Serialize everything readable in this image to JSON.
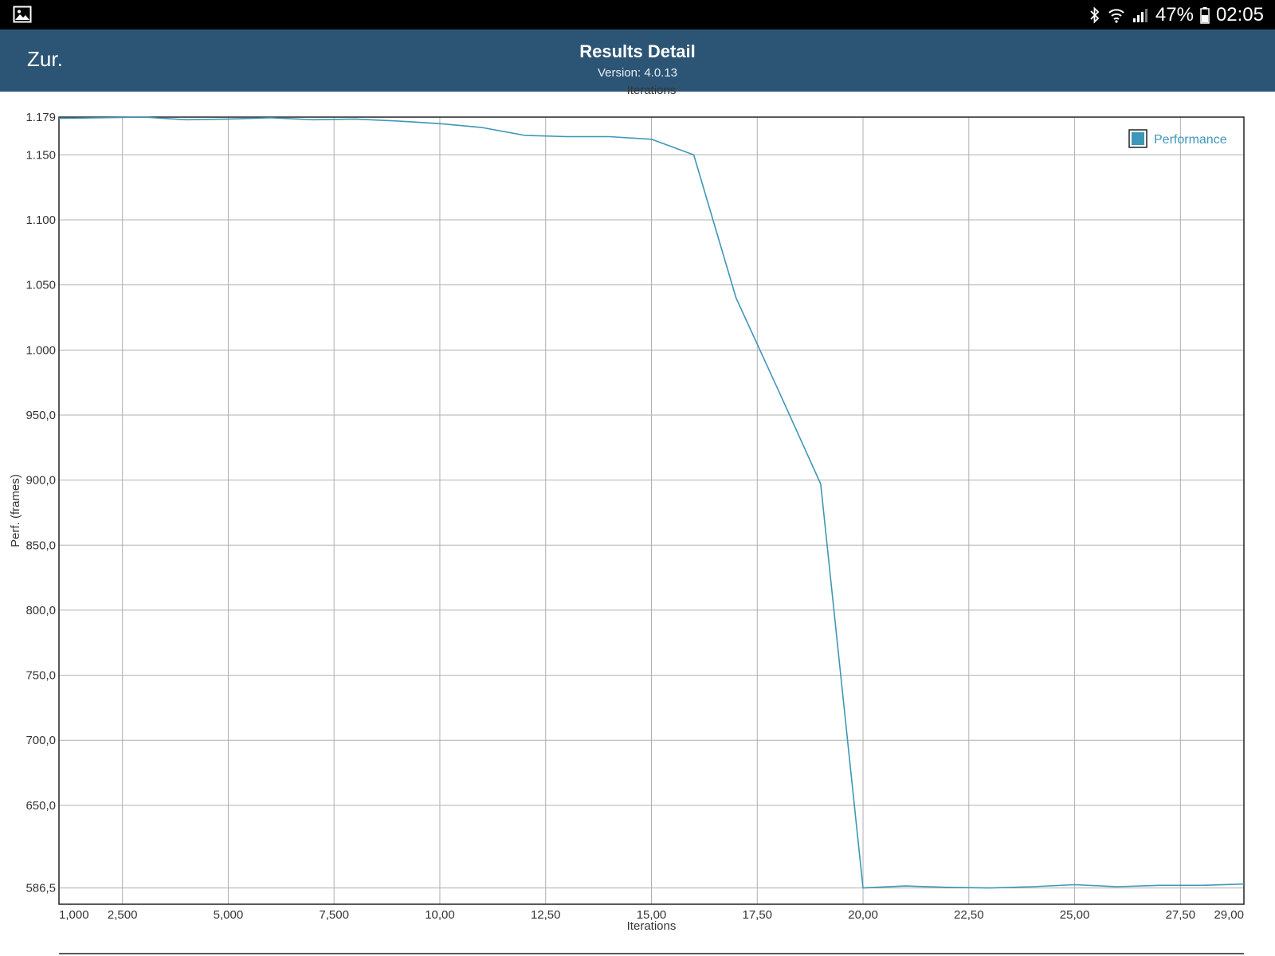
{
  "status_bar": {
    "battery": "47%",
    "time": "02:05",
    "icons": [
      "gallery-icon",
      "bluetooth-icon",
      "wifi-icon",
      "signal-icon",
      "battery-icon"
    ]
  },
  "app_bar": {
    "back_label": "Zur.",
    "title": "Results Detail",
    "subtitle": "Version: 4.0.13"
  },
  "colors": {
    "app_bar": "#2c5575",
    "series": "#3d97b8",
    "grid": "#b0b0b0",
    "frame": "#222222"
  },
  "chart_data": {
    "type": "line",
    "title": "",
    "xlabel": "Iterations",
    "ylabel": "Perf. (frames)",
    "partial_top_label": "Iterations",
    "xlim": [
      1,
      29
    ],
    "ylim": [
      574,
      1179
    ],
    "grid": true,
    "legend_position": "top-right",
    "x_ticks": [
      {
        "value": 1,
        "label": "1,000"
      },
      {
        "value": 2.5,
        "label": "2,500"
      },
      {
        "value": 5,
        "label": "5,000"
      },
      {
        "value": 7.5,
        "label": "7,500"
      },
      {
        "value": 10,
        "label": "10,00"
      },
      {
        "value": 12.5,
        "label": "12,50"
      },
      {
        "value": 15,
        "label": "15,00"
      },
      {
        "value": 17.5,
        "label": "17,50"
      },
      {
        "value": 20,
        "label": "20,00"
      },
      {
        "value": 22.5,
        "label": "22,50"
      },
      {
        "value": 25,
        "label": "25,00"
      },
      {
        "value": 27.5,
        "label": "27,50"
      },
      {
        "value": 29,
        "label": "29,00"
      }
    ],
    "y_ticks": [
      {
        "value": 1179,
        "label": "1.179"
      },
      {
        "value": 1150,
        "label": "1.150"
      },
      {
        "value": 1100,
        "label": "1.100"
      },
      {
        "value": 1050,
        "label": "1.050"
      },
      {
        "value": 1000,
        "label": "1.000"
      },
      {
        "value": 950,
        "label": "950,0"
      },
      {
        "value": 900,
        "label": "900,0"
      },
      {
        "value": 850,
        "label": "850,0"
      },
      {
        "value": 800,
        "label": "800,0"
      },
      {
        "value": 750,
        "label": "750,0"
      },
      {
        "value": 700,
        "label": "700,0"
      },
      {
        "value": 650,
        "label": "650,0"
      },
      {
        "value": 586.5,
        "label": "586,5"
      }
    ],
    "series": [
      {
        "name": "Performance",
        "x": [
          1,
          2,
          3,
          4,
          5,
          6,
          7,
          8,
          9,
          10,
          11,
          12,
          13,
          14,
          15,
          16,
          17,
          18,
          19,
          20,
          21,
          22,
          23,
          24,
          25,
          26,
          27,
          28,
          29
        ],
        "y": [
          1178,
          1178.5,
          1179,
          1177,
          1177.5,
          1178.5,
          1177,
          1177.5,
          1176,
          1174,
          1171,
          1165,
          1164,
          1164,
          1162,
          1150,
          1040,
          969,
          897,
          586.5,
          588,
          587,
          586.5,
          587.5,
          589,
          587.5,
          588.5,
          588.5,
          589.5
        ]
      }
    ]
  }
}
